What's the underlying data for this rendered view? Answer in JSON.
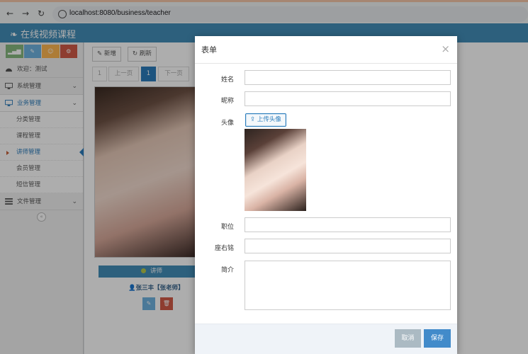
{
  "browser": {
    "url": "localhost:8080/business/teacher"
  },
  "header": {
    "brand": "在线视频课程"
  },
  "sidebar": {
    "welcome": "欢迎：测试",
    "menus": [
      {
        "label": "系统管理"
      },
      {
        "label": "业务管理"
      },
      {
        "label": "文件管理"
      }
    ],
    "sub_items": [
      {
        "label": "分类管理"
      },
      {
        "label": "课程管理"
      },
      {
        "label": "讲师管理"
      },
      {
        "label": "会员管理"
      },
      {
        "label": "短信管理"
      }
    ],
    "collapse_icon": "double-left-icon"
  },
  "toolbar": {
    "add_label": "新增",
    "refresh_label": "刷新"
  },
  "pagination": {
    "first": "1",
    "prev": "上一页",
    "current": "1",
    "next": "下一页"
  },
  "card": {
    "ribbon": "讲师",
    "name": "张三丰【张老师】"
  },
  "modal": {
    "title": "表单",
    "close": "×",
    "labels": {
      "name": "姓名",
      "nickname": "昵称",
      "avatar": "头像",
      "position": "职位",
      "motto": "座右铭",
      "intro": "简介"
    },
    "upload_label": "上传头像",
    "cancel_label": "取消",
    "save_label": "保存"
  },
  "colors": {
    "header": "#438eb9",
    "primary": "#428bca",
    "cancel": "#abbac3"
  }
}
